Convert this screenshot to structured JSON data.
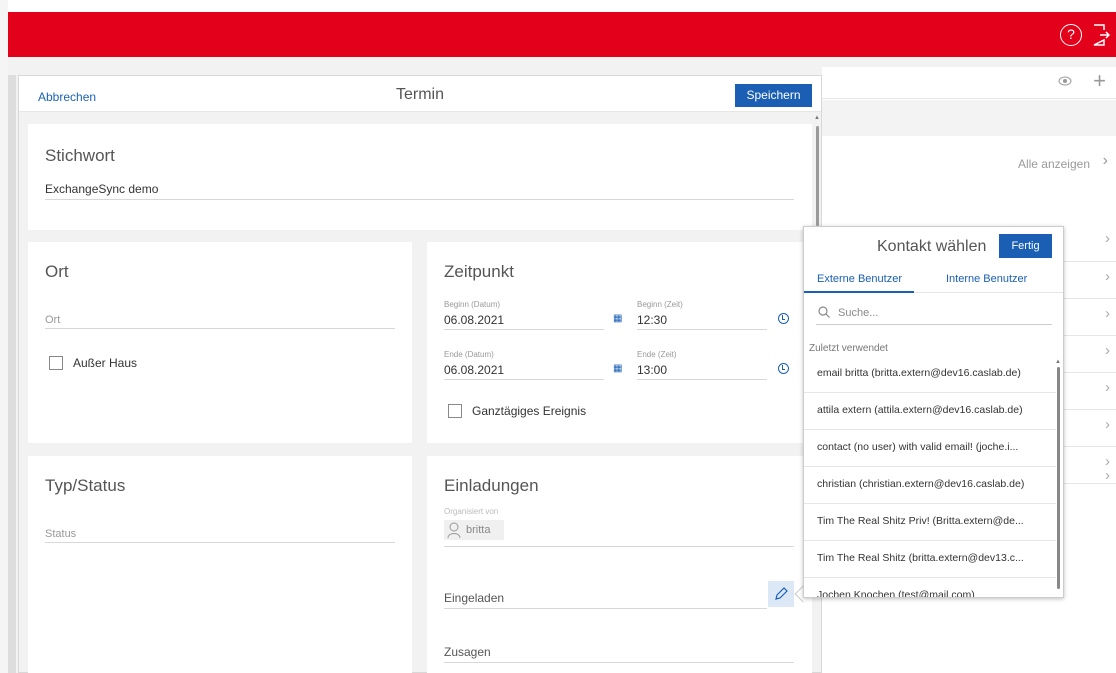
{
  "header": {
    "help_icon": "question-circle-icon",
    "logout_icon": "logout-icon",
    "brand_color": "#e2001a"
  },
  "background": {
    "show_all_label": "Alle anzeigen"
  },
  "dialog": {
    "cancel_label": "Abbrechen",
    "title": "Termin",
    "save_label": "Speichern",
    "keyword": {
      "title": "Stichwort",
      "value": "ExchangeSync demo"
    },
    "location": {
      "title": "Ort",
      "placeholder": "Ort",
      "out_of_office_label": "Außer Haus"
    },
    "time": {
      "title": "Zeitpunkt",
      "start_date_label": "Beginn (Datum)",
      "start_date": "06.08.2021",
      "start_time_label": "Beginn (Zeit)",
      "start_time": "12:30",
      "end_date_label": "Ende (Datum)",
      "end_date": "06.08.2021",
      "end_time_label": "Ende (Zeit)",
      "end_time": "13:00",
      "all_day_label": "Ganztägiges Ereignis"
    },
    "type_status": {
      "title": "Typ/Status",
      "status_placeholder": "Status"
    },
    "invitations": {
      "title": "Einladungen",
      "organizer_label": "Organisiert von",
      "organizer_name": "britta",
      "invited_label": "Eingeladen",
      "accepted_label": "Zusagen"
    }
  },
  "contact_popup": {
    "title": "Kontakt wählen",
    "done_label": "Fertig",
    "tabs": [
      "Externe Benutzer",
      "Interne Benutzer"
    ],
    "search_placeholder": "Suche...",
    "recent_label": "Zuletzt verwendet",
    "items": [
      "email britta (britta.extern@dev16.caslab.de)",
      "attila extern (attila.extern@dev16.caslab.de)",
      "contact (no user) with valid email! (joche.i...",
      "christian (christian.extern@dev16.caslab.de)",
      "Tim The Real Shitz Priv! (Britta.extern@de...",
      "Tim The Real Shitz (britta.extern@dev13.c...",
      "Jochen Knochen (test@mail.com)"
    ]
  }
}
